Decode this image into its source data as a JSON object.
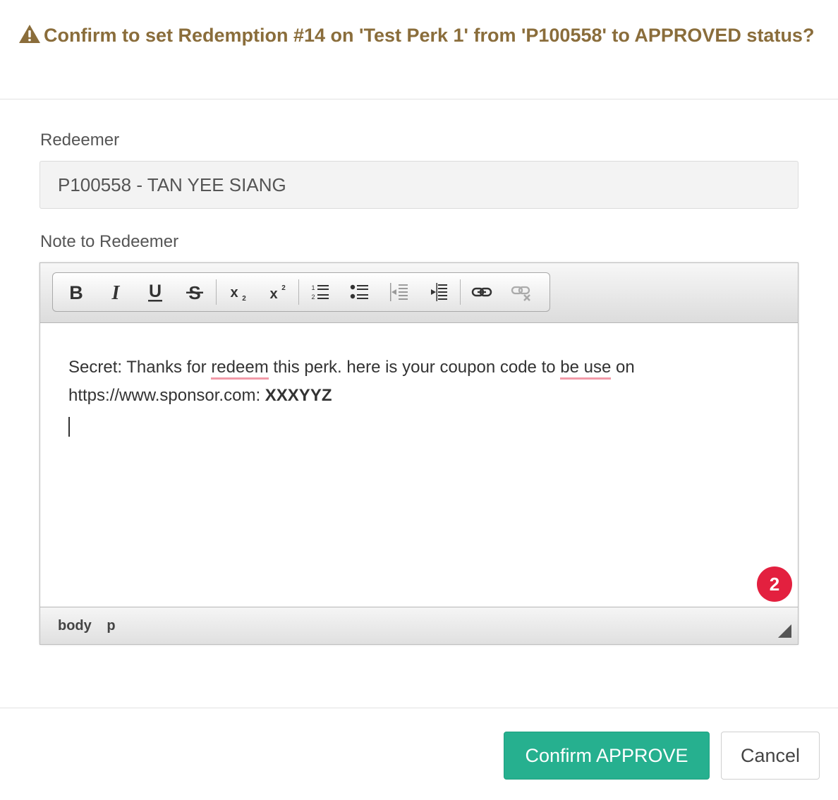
{
  "dialog": {
    "title": "Confirm to set Redemption #14 on 'Test Perk 1' from 'P100558' to APPROVED status?",
    "warning_icon": "warning-triangle-icon",
    "title_color": "#8a6d3b"
  },
  "redeemer": {
    "label": "Redeemer",
    "value": "P100558 - TAN YEE SIANG"
  },
  "note": {
    "label": "Note to Redeemer",
    "toolbar": [
      {
        "name": "bold",
        "icon": "bold-icon"
      },
      {
        "name": "italic",
        "icon": "italic-icon"
      },
      {
        "name": "underline",
        "icon": "underline-icon"
      },
      {
        "name": "strikethrough",
        "icon": "strikethrough-icon"
      },
      {
        "name": "subscript",
        "icon": "subscript-icon"
      },
      {
        "name": "superscript",
        "icon": "superscript-icon"
      },
      {
        "name": "numbered-list",
        "icon": "numbered-list-icon"
      },
      {
        "name": "bulleted-list",
        "icon": "bulleted-list-icon"
      },
      {
        "name": "decrease-indent",
        "icon": "outdent-icon",
        "disabled": true
      },
      {
        "name": "increase-indent",
        "icon": "indent-icon"
      },
      {
        "name": "link",
        "icon": "link-icon"
      },
      {
        "name": "unlink",
        "icon": "unlink-icon",
        "disabled": true
      }
    ],
    "content": {
      "t1": "Secret: Thanks for ",
      "w1": "redeem",
      "t2": " this perk. here is your coupon code to ",
      "w2": "be use",
      "t3": " on",
      "t4": "https://www.sponsor.com: ",
      "code": "XXXYYZ"
    },
    "badge_count": "2",
    "path": [
      "body",
      "p"
    ]
  },
  "footer": {
    "confirm_label": "Confirm APPROVE",
    "cancel_label": "Cancel",
    "confirm_color": "#26b08f"
  }
}
